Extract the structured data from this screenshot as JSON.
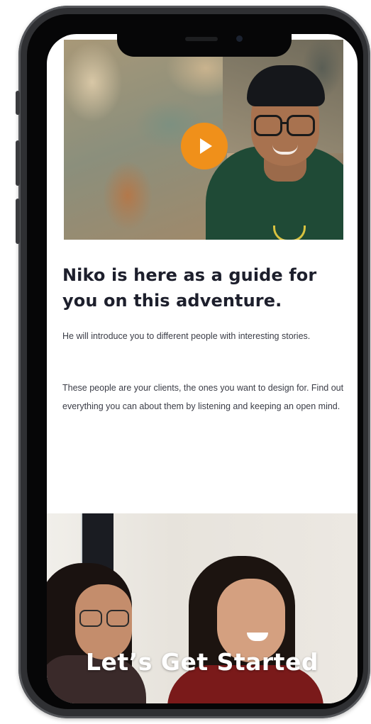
{
  "hero": {
    "play_icon": "play-icon",
    "accent_color": "#f0901a"
  },
  "content": {
    "title": "Niko is here as a guide for you on this adventure.",
    "paragraph_1": "He will introduce you to different people with interesting stories.",
    "paragraph_2": "These people are your clients, the ones you want to design for. Find out everything you can about them by listening and keeping an open mind."
  },
  "cta": {
    "label": "Let’s Get Started"
  }
}
